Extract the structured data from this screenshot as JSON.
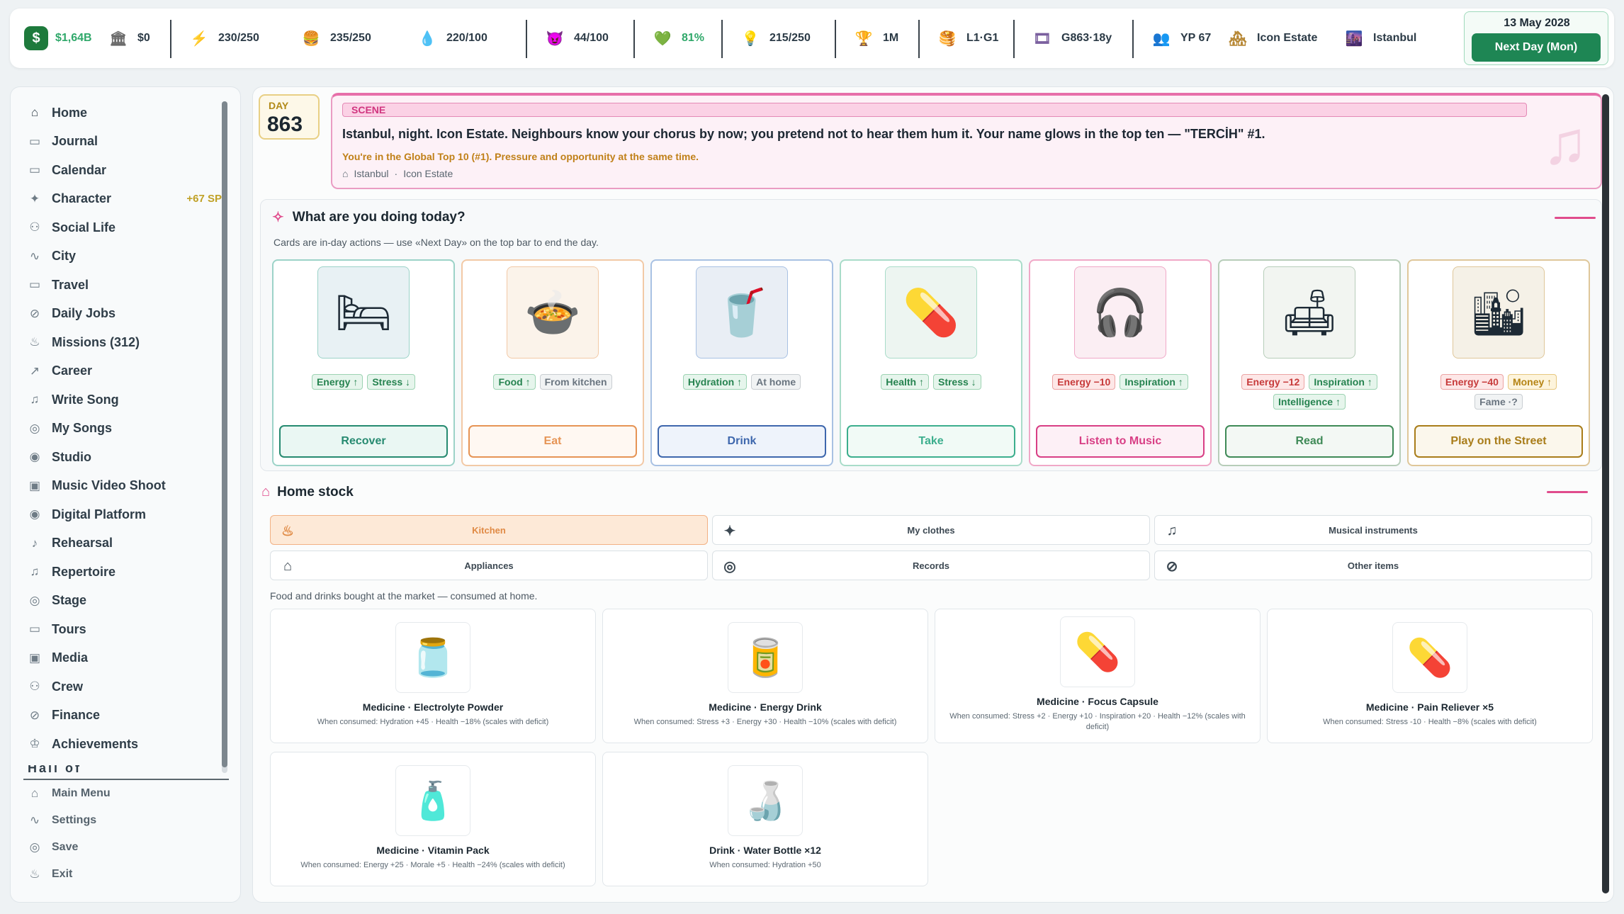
{
  "topbar": {
    "money": "$1,64B",
    "bank": "$0",
    "energy": "230/250",
    "food": "235/250",
    "hydration": "220/100",
    "stress": "44/100",
    "health": "81%",
    "inspiration": "215/250",
    "fame": "1M",
    "level": "L1·G1",
    "genre": "G863·18y",
    "yp": "YP 67",
    "home": "Icon Estate",
    "city": "Istanbul",
    "date": "13 May 2028",
    "next_day": "Next Day (Mon)"
  },
  "sidebar": {
    "items": [
      {
        "label": "Home",
        "icon": "home-icon",
        "glyph": "⌂"
      },
      {
        "label": "Journal",
        "icon": "calendar-icon",
        "glyph": "▭"
      },
      {
        "label": "Calendar",
        "icon": "calendar-icon",
        "glyph": "▭"
      },
      {
        "label": "Character",
        "icon": "sparkle-icon",
        "glyph": "✦",
        "badge": "+67 SP"
      },
      {
        "label": "Social Life",
        "icon": "people-icon",
        "glyph": "⚇"
      },
      {
        "label": "City",
        "icon": "pulse-icon",
        "glyph": "∿"
      },
      {
        "label": "Travel",
        "icon": "calendar-icon",
        "glyph": "▭"
      },
      {
        "label": "Daily Jobs",
        "icon": "link-icon",
        "glyph": "⊘"
      },
      {
        "label": "Missions (312)",
        "icon": "flame-icon",
        "glyph": "♨"
      },
      {
        "label": "Career",
        "icon": "trend-icon",
        "glyph": "↗"
      },
      {
        "label": "Write Song",
        "icon": "music-note-icon",
        "glyph": "♫"
      },
      {
        "label": "My Songs",
        "icon": "record-icon",
        "glyph": "◎"
      },
      {
        "label": "Studio",
        "icon": "broadcast-icon",
        "glyph": "◉"
      },
      {
        "label": "Music Video Shoot",
        "icon": "camera-icon",
        "glyph": "▣"
      },
      {
        "label": "Digital Platform",
        "icon": "broadcast-icon",
        "glyph": "◉"
      },
      {
        "label": "Rehearsal",
        "icon": "mic-icon",
        "glyph": "♪"
      },
      {
        "label": "Repertoire",
        "icon": "music-note-icon",
        "glyph": "♫"
      },
      {
        "label": "Stage",
        "icon": "record-icon",
        "glyph": "◎"
      },
      {
        "label": "Tours",
        "icon": "calendar-icon",
        "glyph": "▭"
      },
      {
        "label": "Media",
        "icon": "camera-icon",
        "glyph": "▣"
      },
      {
        "label": "Crew",
        "icon": "people-icon",
        "glyph": "⚇"
      },
      {
        "label": "Finance",
        "icon": "link-icon",
        "glyph": "⊘"
      },
      {
        "label": "Achievements",
        "icon": "award-icon",
        "glyph": "♔"
      }
    ],
    "partial": "Hall of Fame",
    "bottom": [
      {
        "label": "Main Menu",
        "icon": "home-icon",
        "glyph": "⌂"
      },
      {
        "label": "Settings",
        "icon": "pulse-icon",
        "glyph": "∿"
      },
      {
        "label": "Save",
        "icon": "record-icon",
        "glyph": "◎"
      },
      {
        "label": "Exit",
        "icon": "flame-icon",
        "glyph": "♨"
      }
    ]
  },
  "day": {
    "label": "DAY",
    "number": "863"
  },
  "scene": {
    "label": "SCENE",
    "text": "Istanbul, night. Icon Estate. Neighbours know your chorus by now; you pretend not to hear them hum it. Your name glows in the top ten — \"TERCİH\" #1.",
    "sub": "You're in the Global Top 10 (#1). Pressure and opportunity at the same time.",
    "location_city": "Istanbul",
    "location_sep": "·",
    "location_home": "Icon Estate"
  },
  "actions": {
    "title": "What are you doing today?",
    "subtitle": "Cards are in-day actions — use «Next Day» on the top bar to end the day.",
    "cards": [
      {
        "name": "recover",
        "img": "🛏",
        "bg": "#e8f1f4",
        "border": "#9cd3c8",
        "btn_color": "#268a70",
        "btn_bg": "#eaf7f3",
        "tags": [
          {
            "text": "Energy ↑",
            "kind": "green"
          },
          {
            "text": "Stress ↓",
            "kind": "green"
          }
        ],
        "button": "Recover"
      },
      {
        "name": "eat",
        "img": "🍲",
        "bg": "#fbf3ea",
        "border": "#f2c9a6",
        "btn_color": "#e69455",
        "btn_bg": "#fff8f2",
        "tags": [
          {
            "text": "Food ↑",
            "kind": "green"
          },
          {
            "text": "From kitchen",
            "kind": "gray"
          }
        ],
        "button": "Eat"
      },
      {
        "name": "drink",
        "img": "🥤",
        "bg": "#e9eef5",
        "border": "#a8c1e3",
        "btn_color": "#3e67ad",
        "btn_bg": "#eef3fb",
        "tags": [
          {
            "text": "Hydration ↑",
            "kind": "green"
          },
          {
            "text": "At home",
            "kind": "gray"
          }
        ],
        "button": "Drink"
      },
      {
        "name": "take",
        "img": "💊",
        "bg": "#edf5f1",
        "border": "#a9dcc9",
        "btn_color": "#3cae8d",
        "btn_bg": "#f1faf6",
        "tags": [
          {
            "text": "Health ↑",
            "kind": "green"
          },
          {
            "text": "Stress ↓",
            "kind": "green"
          }
        ],
        "button": "Take"
      },
      {
        "name": "listen-music",
        "img": "🎧",
        "bg": "#fbeef3",
        "border": "#f0a8c7",
        "btn_color": "#d83f85",
        "btn_bg": "#fdf0f6",
        "tags": [
          {
            "text": "Energy −10",
            "kind": "red"
          },
          {
            "text": "Inspiration ↑",
            "kind": "green"
          }
        ],
        "button": "Listen to Music"
      },
      {
        "name": "read",
        "img": "🛋",
        "bg": "#f2f5f1",
        "border": "#b7cdb9",
        "btn_color": "#3f8a57",
        "btn_bg": "#f3f8f4",
        "tags": [
          {
            "text": "Energy −12",
            "kind": "red"
          },
          {
            "text": "Inspiration ↑",
            "kind": "green"
          },
          {
            "text": "Intelligence ↑",
            "kind": "green"
          }
        ],
        "button": "Read"
      },
      {
        "name": "play-street",
        "img": "🏙",
        "bg": "#f5f1e7",
        "border": "#dfc79a",
        "btn_color": "#a97d1a",
        "btn_bg": "#fbf7ec",
        "tags": [
          {
            "text": "Energy −40",
            "kind": "red"
          },
          {
            "text": "Money ↑",
            "kind": "gold"
          },
          {
            "text": "Fame ·?",
            "kind": "gray"
          }
        ],
        "button": "Play on the Street"
      }
    ]
  },
  "stock": {
    "title": "Home stock",
    "tabs": [
      {
        "label": "Kitchen",
        "icon": "flame-icon",
        "glyph": "♨",
        "active": true
      },
      {
        "label": "My clothes",
        "icon": "sparkle-icon",
        "glyph": "✦",
        "active": false
      },
      {
        "label": "Musical instruments",
        "icon": "music-note-icon",
        "glyph": "♫",
        "active": false
      },
      {
        "label": "Appliances",
        "icon": "home-icon",
        "glyph": "⌂",
        "active": false
      },
      {
        "label": "Records",
        "icon": "record-icon",
        "glyph": "◎",
        "active": false
      },
      {
        "label": "Other items",
        "icon": "link-icon",
        "glyph": "⊘",
        "active": false
      }
    ],
    "caption": "Food and drinks bought at the market — consumed at home.",
    "items": [
      {
        "name": "Medicine · Electrolyte Powder",
        "img": "🫙",
        "desc": "When consumed: Hydration +45 · Health −18% (scales with deficit)"
      },
      {
        "name": "Medicine · Energy Drink",
        "img": "🥫",
        "desc": "When consumed: Stress +3 · Energy +30 · Health −10% (scales with deficit)"
      },
      {
        "name": "Medicine · Focus Capsule",
        "img": "💊",
        "desc": "When consumed: Stress +2 · Energy +10 · Inspiration +20 · Health −12% (scales with deficit)"
      },
      {
        "name": "Medicine · Pain Reliever ×5",
        "img": "💊",
        "desc": "When consumed: Stress -10 · Health −8% (scales with deficit)"
      },
      {
        "name": "Medicine · Vitamin Pack",
        "img": "🧴",
        "desc": "When consumed: Energy +25 · Morale +5 · Health −24% (scales with deficit)"
      },
      {
        "name": "Drink · Water Bottle ×12",
        "img": "🍶",
        "desc": "When consumed: Hydration +50"
      }
    ]
  }
}
